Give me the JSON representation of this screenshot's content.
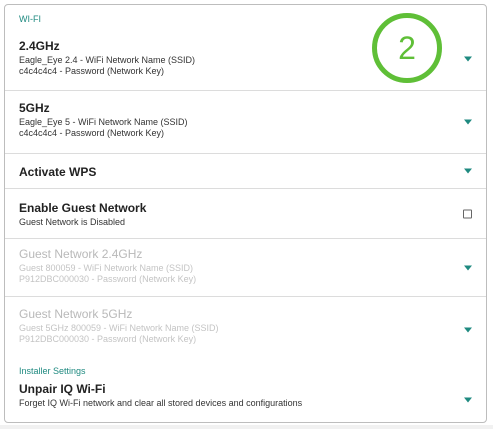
{
  "wifi": {
    "header": "WI-FI",
    "items": [
      {
        "title": "2.4GHz",
        "line1": "Eagle_Eye 2.4 - WiFi Network Name (SSID)",
        "line2": "c4c4c4c4 - Password (Network Key)"
      },
      {
        "title": "5GHz",
        "line1": "Eagle_Eye 5 - WiFi Network Name (SSID)",
        "line2": "c4c4c4c4 - Password (Network Key)"
      },
      {
        "title": "Activate WPS"
      },
      {
        "title": "Enable Guest Network",
        "line1": "Guest Network is Disabled"
      },
      {
        "title": "Guest Network 2.4GHz",
        "line1": "Guest 800059 - WiFi Network Name (SSID)",
        "line2": "P912DBC000030 - Password (Network Key)"
      },
      {
        "title": "Guest Network 5GHz",
        "line1": "Guest 5GHz 800059 - WiFi Network Name (SSID)",
        "line2": "P912DBC000030 - Password (Network Key)"
      }
    ]
  },
  "installer": {
    "header": "Installer Settings",
    "items": [
      {
        "title": "Unpair IQ Wi-Fi",
        "line1": "Forget IQ Wi-Fi network and clear all stored devices and configurations"
      }
    ]
  },
  "annotation": {
    "number": "2",
    "color": "#5fbf37"
  },
  "colors": {
    "accent": "#1f8a80",
    "disabled_text": "#b9b9b9"
  },
  "icons": {
    "dropdown": "chevron-down-icon",
    "checkbox": "checkbox-icon"
  }
}
